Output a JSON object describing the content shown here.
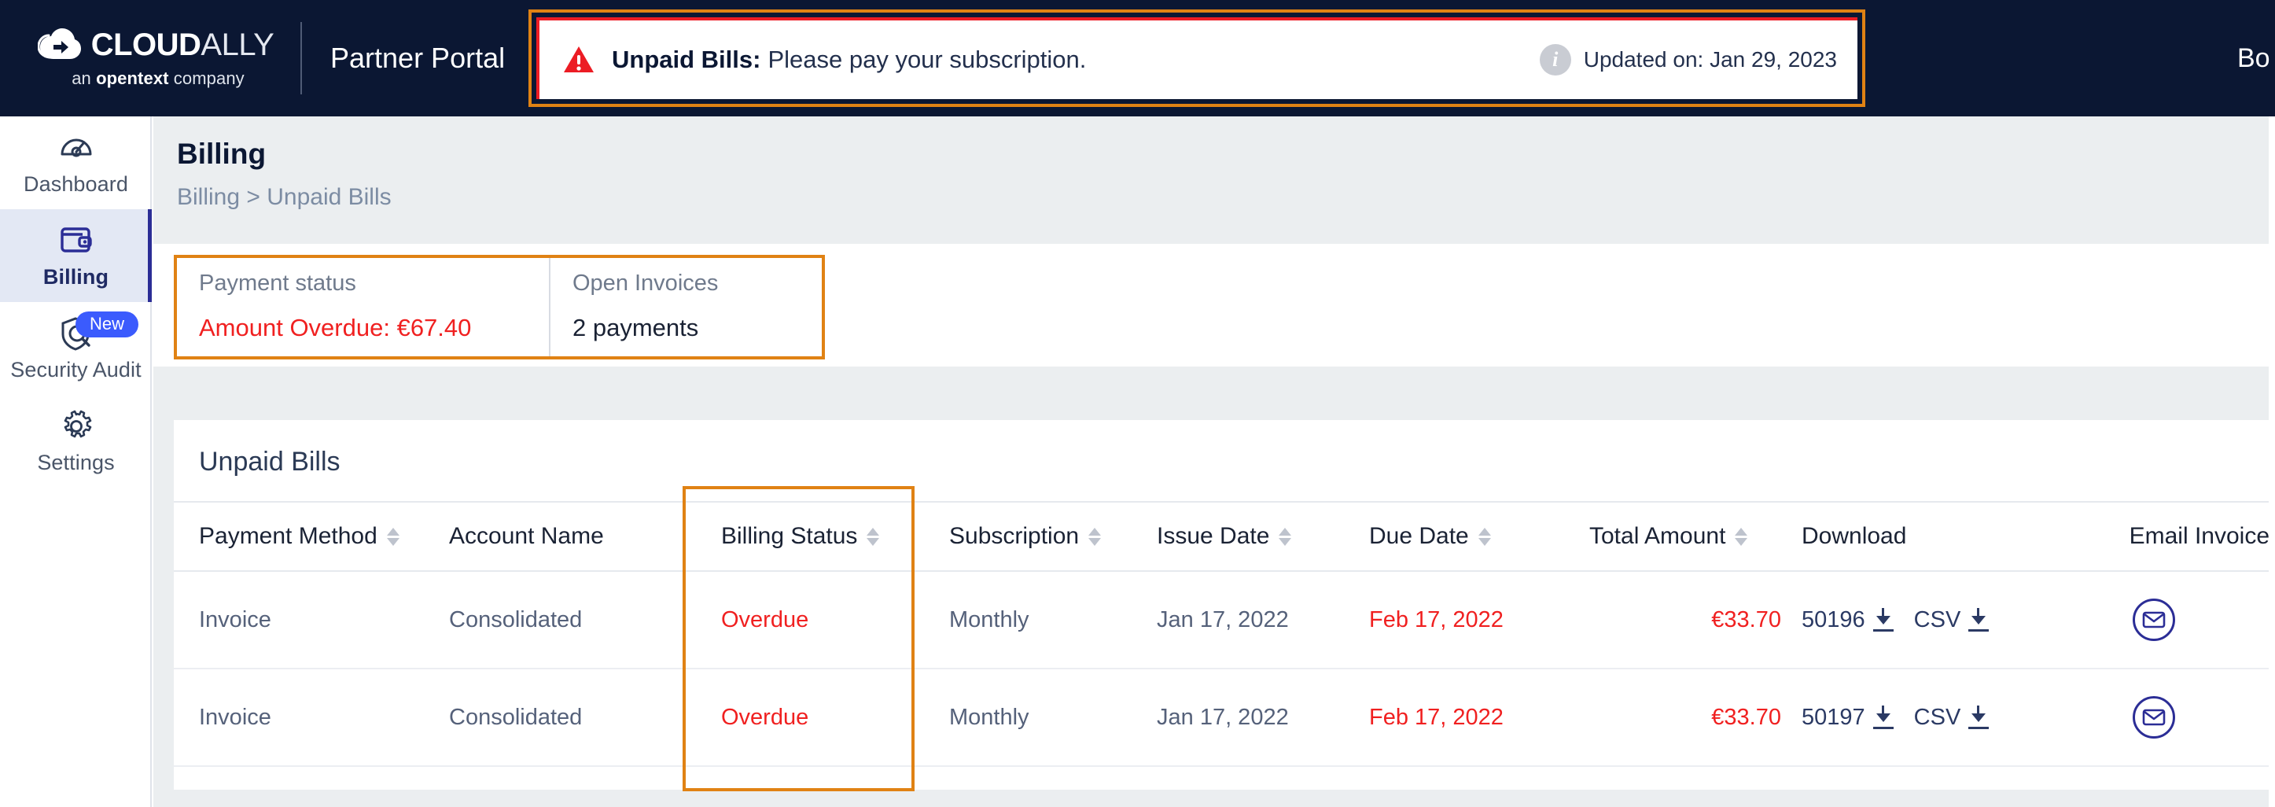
{
  "brand": {
    "name_bold": "CLOUD",
    "name_light": "ALLY",
    "tagline_pre": "an ",
    "tagline_bold": "opentext",
    "tagline_post": " company",
    "logo_icon": "cloud-icon",
    "portal_title": "Partner Portal",
    "back_link": "Bo",
    "accent_navy": "#0b1733",
    "accent_indigo": "#2b2d96",
    "accent_orange": "#e08214",
    "accent_red": "#f02020"
  },
  "alert": {
    "icon": "warning-triangle-icon",
    "title": "Unpaid Bills:",
    "message": "Please pay your subscription.",
    "info_icon": "info-circle-icon",
    "updated_label": "Updated on: Jan 29, 2023"
  },
  "sidebar": {
    "items": [
      {
        "label": "Dashboard",
        "icon": "speedometer-icon",
        "active": false,
        "badge": null
      },
      {
        "label": "Billing",
        "icon": "wallet-icon",
        "active": true,
        "badge": null
      },
      {
        "label": "Security Audit",
        "icon": "shield-search-icon",
        "active": false,
        "badge": "New"
      },
      {
        "label": "Settings",
        "icon": "gear-icon",
        "active": false,
        "badge": null
      }
    ]
  },
  "page": {
    "title": "Billing",
    "breadcrumb": "Billing > Unpaid Bills"
  },
  "summary": {
    "cards": [
      {
        "label": "Payment status",
        "value": "Amount Overdue: €67.40",
        "danger": true
      },
      {
        "label": "Open Invoices",
        "value": "2 payments",
        "danger": false
      }
    ]
  },
  "table": {
    "title": "Unpaid Bills",
    "columns": [
      {
        "label": "Payment Method",
        "sortable": true
      },
      {
        "label": "Account Name",
        "sortable": false
      },
      {
        "label": "Billing Status",
        "sortable": true
      },
      {
        "label": "Subscription",
        "sortable": true
      },
      {
        "label": "Issue Date",
        "sortable": true
      },
      {
        "label": "Due Date",
        "sortable": true
      },
      {
        "label": "Total Amount",
        "sortable": true
      },
      {
        "label": "Download",
        "sortable": false
      },
      {
        "label": "Email Invoice",
        "sortable": false
      }
    ],
    "rows": [
      {
        "payment_method": "Invoice",
        "account_name": "Consolidated",
        "billing_status": "Overdue",
        "subscription": "Monthly",
        "issue_date": "Jan 17, 2022",
        "due_date": "Feb 17, 2022",
        "total_amount": "€33.70",
        "download_id": "50196",
        "download_csv": "CSV",
        "email_icon": "envelope-circle-icon"
      },
      {
        "payment_method": "Invoice",
        "account_name": "Consolidated",
        "billing_status": "Overdue",
        "subscription": "Monthly",
        "issue_date": "Jan 17, 2022",
        "due_date": "Feb 17, 2022",
        "total_amount": "€33.70",
        "download_id": "50197",
        "download_csv": "CSV",
        "email_icon": "envelope-circle-icon"
      }
    ]
  }
}
